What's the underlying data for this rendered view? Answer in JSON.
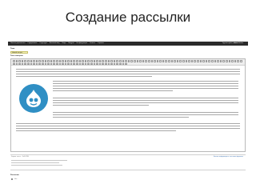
{
  "slide": {
    "title": "Создание рассылки"
  },
  "adminbar": {
    "menu": [
      "Панель управления",
      "Содержимое",
      "Структура",
      "Внешний вид",
      "Люди",
      "Модули",
      "Конфигурация",
      "Отчёты",
      "Справка"
    ],
    "user_greeting": "Здравствуйте,",
    "user_name": "admin",
    "logout": "Выйти"
  },
  "form": {
    "title_label": "Тема",
    "title_value": "Новый выпуск",
    "body_label": "Текст выпуска"
  },
  "footer": {
    "format_label": "Формат текста",
    "format_value": "Full HTML",
    "format_help_link": "Больше информации о текстовых форматах",
    "newsletter_label": "Рассылка",
    "radio_label": "- Нет -"
  },
  "icons": {
    "logo": "drupal-drop-icon",
    "toolbar": "editor-toolbar-icon"
  },
  "colors": {
    "adminbar": "#2b2b2b",
    "title_input": "#f4f2b8",
    "logo_bg": "#2f8fc4"
  }
}
